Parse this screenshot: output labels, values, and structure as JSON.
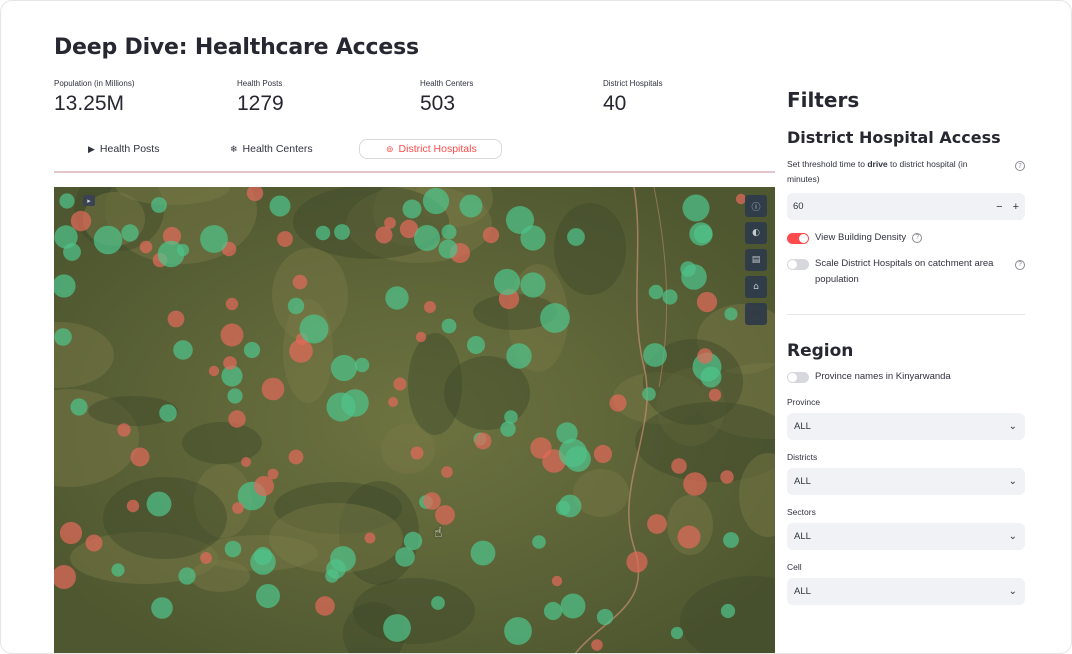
{
  "page_title": "Deep Dive: Healthcare Access",
  "metrics": [
    {
      "label": "Population (in Millions)",
      "value": "13.25M"
    },
    {
      "label": "Health Posts",
      "value": "1279"
    },
    {
      "label": "Health Centers",
      "value": "503"
    },
    {
      "label": "District Hospitals",
      "value": "40"
    }
  ],
  "tabs": [
    {
      "label": "Health Posts",
      "icon": "play-icon",
      "glyph": "▶",
      "active": false
    },
    {
      "label": "Health Centers",
      "icon": "asterisk-icon",
      "glyph": "❄",
      "active": false
    },
    {
      "label": "District Hospitals",
      "icon": "target-icon",
      "glyph": "⊚",
      "active": true
    }
  ],
  "map": {
    "controls": [
      {
        "name": "info-icon",
        "glyph": "ⓘ"
      },
      {
        "name": "layers-icon",
        "glyph": "◐"
      },
      {
        "name": "table-icon",
        "glyph": "▤"
      },
      {
        "name": "map-outline-icon",
        "glyph": "⌂"
      },
      {
        "name": "language-en-button",
        "glyph": "EN"
      }
    ],
    "toggle_glyph": "▸",
    "colors": {
      "health_center": "#4fc38a",
      "district_hospital": "#e06a5a",
      "terrain": "#5f6536"
    }
  },
  "sidebar": {
    "title": "Filters",
    "access_title": "District Hospital Access",
    "threshold_label_pre": "Set threshold time to ",
    "threshold_label_bold": "drive",
    "threshold_label_post": " to district hospital (in minutes)",
    "threshold_value": "60",
    "stepper_minus": "−",
    "stepper_plus": "+",
    "help_glyph": "?",
    "toggle_building_density": {
      "label": "View Building Density",
      "on": true
    },
    "toggle_scale_hospitals": {
      "label": "Scale District Hospitals on catchment area population",
      "on": false
    },
    "region_title": "Region",
    "toggle_province_names": {
      "label": "Province names in Kinyarwanda",
      "on": false
    },
    "selects": [
      {
        "label": "Province",
        "value": "ALL"
      },
      {
        "label": "Districts",
        "value": "ALL"
      },
      {
        "label": "Sectors",
        "value": "ALL"
      },
      {
        "label": "Cell",
        "value": "ALL"
      }
    ],
    "chevron_glyph": "⌄"
  },
  "cursor_glyph": "☝"
}
